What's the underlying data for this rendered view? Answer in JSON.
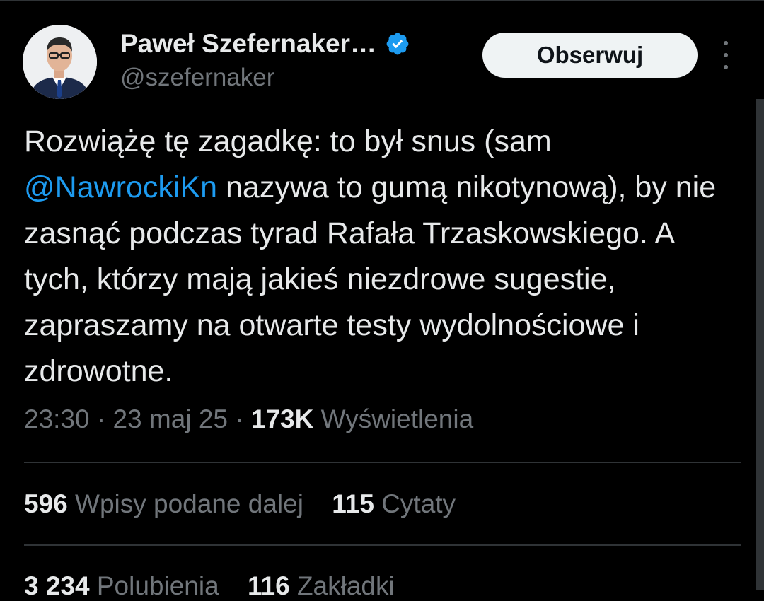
{
  "author": {
    "name": "Paweł Szefernaker…",
    "handle": "@szefernaker"
  },
  "follow_label": "Obserwuj",
  "tweet": {
    "text_before": "Rozwiążę tę zagadkę: to był snus (sam ",
    "mention": "@NawrockiKn",
    "text_after": " nazywa to gumą nikotynową), by nie zasnąć podczas tyrad Rafała Trzaskowskiego. A tych, którzy mają jakieś niezdrowe sugestie, zapraszamy na otwarte testy wydolnościowe i zdrowotne."
  },
  "meta": {
    "time": "23:30",
    "date": "23 maj 25",
    "views_count": "173K",
    "views_label": "Wyświetlenia"
  },
  "stats": {
    "reposts_count": "596",
    "reposts_label": "Wpisy podane dalej",
    "quotes_count": "115",
    "quotes_label": "Cytaty",
    "likes_count": "3 234",
    "likes_label": "Polubienia",
    "bookmarks_count": "116",
    "bookmarks_label": "Zakładki"
  },
  "colors": {
    "background": "#000000",
    "text": "#e7e9ea",
    "muted": "#71767b",
    "link": "#1d9bf0",
    "verified": "#1d9bf0",
    "divider": "#2f3336"
  },
  "icons": [
    "avatar",
    "verified-badge-icon",
    "more-options-icon"
  ]
}
